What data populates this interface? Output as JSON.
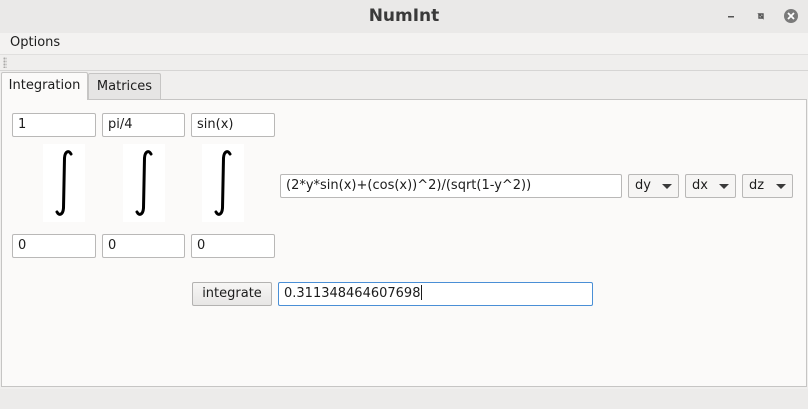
{
  "window": {
    "title": "NumInt",
    "minimize_icon": "minimize-icon",
    "maximize_icon": "maximize-icon",
    "close_icon": "close-icon",
    "close_color": "#7a7a7a"
  },
  "menubar": {
    "items": [
      {
        "label": "Options"
      }
    ]
  },
  "tabs": [
    {
      "label": "Integration",
      "active": true
    },
    {
      "label": "Matrices",
      "active": false
    }
  ],
  "integration": {
    "upper_limits": [
      "1",
      "pi/4",
      "sin(x)"
    ],
    "lower_limits": [
      "0",
      "0",
      "0"
    ],
    "integral_symbol_icon": "integral-sign-icon",
    "integrand": "(2*y*sin(x)+(cos(x))^2)/(sqrt(1-y^2))",
    "variables": [
      "dy",
      "dx",
      "dz"
    ],
    "integrate_label": "integrate",
    "result": "0.311348464607698"
  }
}
